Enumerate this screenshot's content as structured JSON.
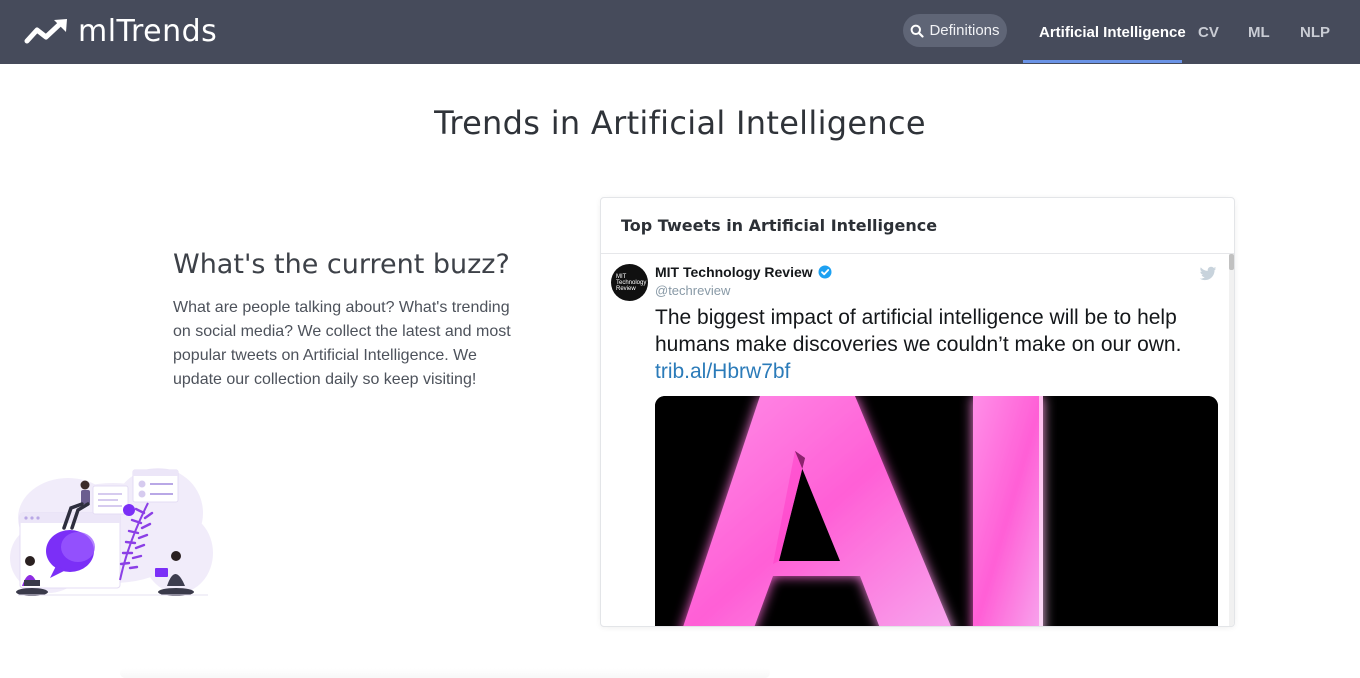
{
  "navbar": {
    "brand": "mlTrends",
    "definitions_label": "Definitions",
    "links": [
      {
        "label": "Artificial Intelligence",
        "active": true
      },
      {
        "label": "CV",
        "active": false
      },
      {
        "label": "ML",
        "active": false
      },
      {
        "label": "NLP",
        "active": false
      }
    ],
    "icons": {
      "brand": "trend-arrow-icon",
      "search": "search-icon"
    },
    "colors": {
      "bar": "#464b5b",
      "active_underline": "#6a93e6"
    }
  },
  "page": {
    "title": "Trends in Artificial Intelligence",
    "buzz_heading": "What's the current buzz?",
    "buzz_text": "What are people talking about? What's trending on social media? We collect the latest and most popular tweets on Artificial Intelligence. We update our collection daily so keep visiting!"
  },
  "tweets_card": {
    "header": "Top Tweets in Artificial Intelligence",
    "tweet": {
      "avatar_text": "MIT Technology Review",
      "author": "MIT Technology Review",
      "handle": "@techreview",
      "text": "The biggest impact of artificial intelligence will be to help humans make discoveries we couldn’t make on our own.",
      "link": "trib.al/Hbrw7bf",
      "image_text": "AI",
      "icons": {
        "verified": "verified-badge-icon",
        "brand": "twitter-bird-icon"
      },
      "colors": {
        "link": "#2b7bb9",
        "image_glow": "#ff4fd8"
      }
    }
  }
}
